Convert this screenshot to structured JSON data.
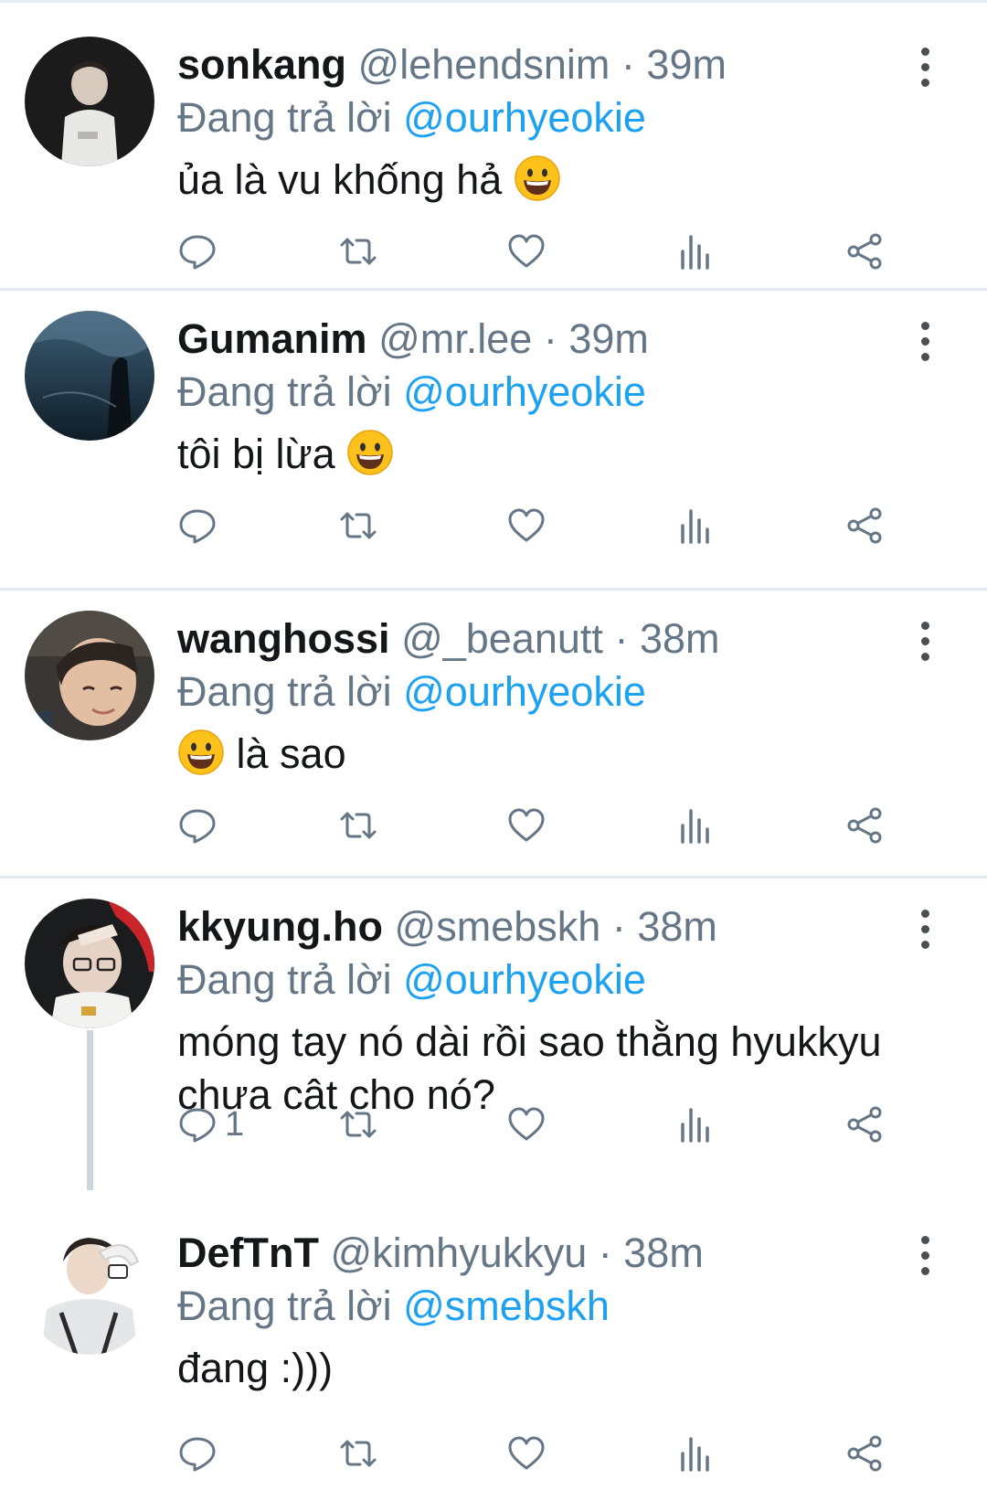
{
  "replying_prefix": "Đang trả lời",
  "tweets": [
    {
      "name": "sonkang",
      "handle": "@lehendsnim",
      "dot": "·",
      "time": "39m",
      "reply_to": "@ourhyeokie",
      "text": "ủa là vu khống hả",
      "reply_count": ""
    },
    {
      "name": "Gumanim",
      "handle": "@mr.lee",
      "dot": "·",
      "time": "39m",
      "reply_to": "@ourhyeokie",
      "text": "tôi bị lừa",
      "reply_count": ""
    },
    {
      "name": "wanghossi",
      "handle": "@_beanutt",
      "dot": "·",
      "time": "38m",
      "reply_to": "@ourhyeokie",
      "text": "là sao",
      "reply_count": ""
    },
    {
      "name": "kkyung.ho",
      "handle": "@smebskh",
      "dot": "·",
      "time": "38m",
      "reply_to": "@ourhyeokie",
      "text": "móng tay nó dài rồi sao thằng hyukkyu chưa cât cho nó?",
      "reply_count": "1"
    },
    {
      "name": "DefTnT",
      "handle": "@kimhyukkyu",
      "dot": "·",
      "time": "38m",
      "reply_to": "@smebskh",
      "text": "đang :)))",
      "reply_count": ""
    }
  ],
  "icons": {
    "reply": "reply-icon",
    "retweet": "retweet-icon",
    "like": "heart-icon",
    "analytics": "analytics-icon",
    "share": "share-icon",
    "more": "more-icon",
    "emoji": "grinning-face-emoji"
  },
  "colors": {
    "link": "#1da1f2",
    "muted": "#657786",
    "text": "#14171a"
  }
}
